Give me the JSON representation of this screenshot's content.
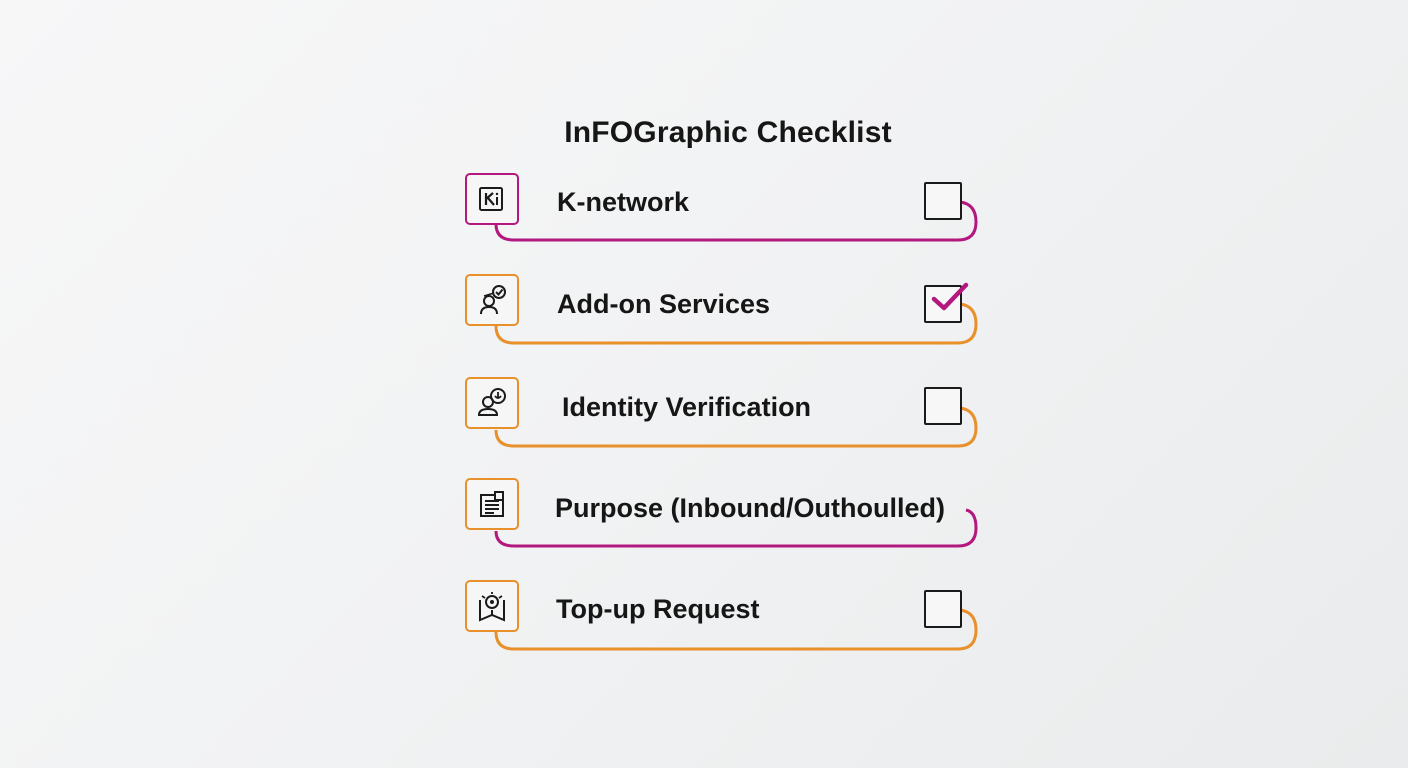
{
  "title": "InFOGraphic Checklist",
  "colors": {
    "magenta": "#b3187e",
    "orange": "#e8902c",
    "check_mark": "#b3187e"
  },
  "items": [
    {
      "label": "K-network",
      "icon": "k-network-icon",
      "accent": "magenta",
      "checked": false
    },
    {
      "label": "Add-on Services",
      "icon": "user-check-icon",
      "accent": "orange",
      "checked": true
    },
    {
      "label": "Identity Verification",
      "icon": "user-badge-icon",
      "accent": "orange",
      "checked": false
    },
    {
      "label": "Purpose (Inbound/Outhoulled)",
      "icon": "document-icon",
      "accent": "orange",
      "checked": null
    },
    {
      "label": "Top-up Request",
      "icon": "pin-book-icon",
      "accent": "orange",
      "checked": false
    }
  ]
}
